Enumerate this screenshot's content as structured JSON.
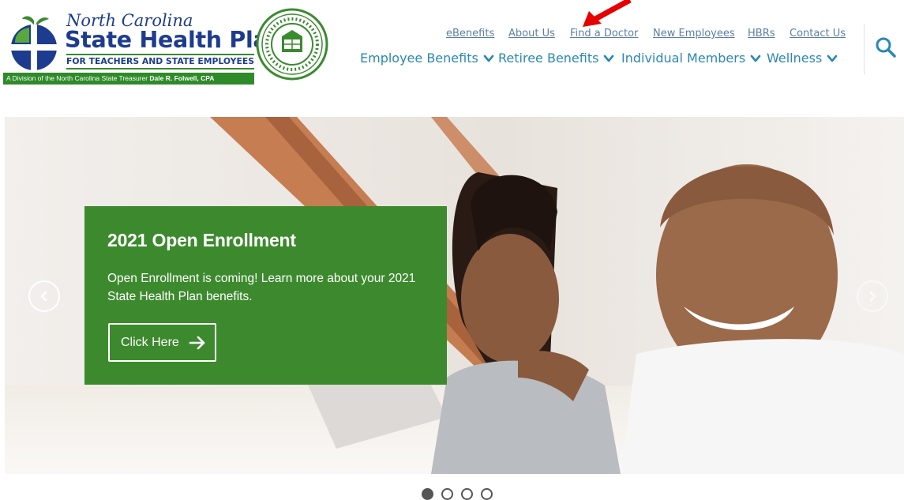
{
  "logo": {
    "line1": "North Carolina",
    "line2": "State Health Plan",
    "line3": "FOR TEACHERS AND STATE EMPLOYEES",
    "division_prefix": "A Division of the North Carolina State Treasurer",
    "division_name": "Dale R. Folwell, CPA"
  },
  "utility_nav": [
    {
      "label": "eBenefits"
    },
    {
      "label": "About Us"
    },
    {
      "label": "Find a Doctor"
    },
    {
      "label": "New Employees"
    },
    {
      "label": "HBRs"
    },
    {
      "label": "Contact Us"
    }
  ],
  "main_nav": [
    {
      "label": "Employee Benefits"
    },
    {
      "label": "Retiree Benefits"
    },
    {
      "label": "Individual Members"
    },
    {
      "label": "Wellness"
    }
  ],
  "search": {
    "icon": "search-icon"
  },
  "hero": {
    "title": "2021 Open Enrollment",
    "text": "Open Enrollment is coming! Learn more about your 2021 State Health Plan benefits.",
    "button_label": "Click Here",
    "slide_count": 4,
    "active_slide": 1
  },
  "colors": {
    "brand_blue": "#1e3c8f",
    "nav_blue": "#2a87b5",
    "util_link": "#5b7fa4",
    "promo_green": "#3d8a2e",
    "annotation_red": "#e60000"
  }
}
